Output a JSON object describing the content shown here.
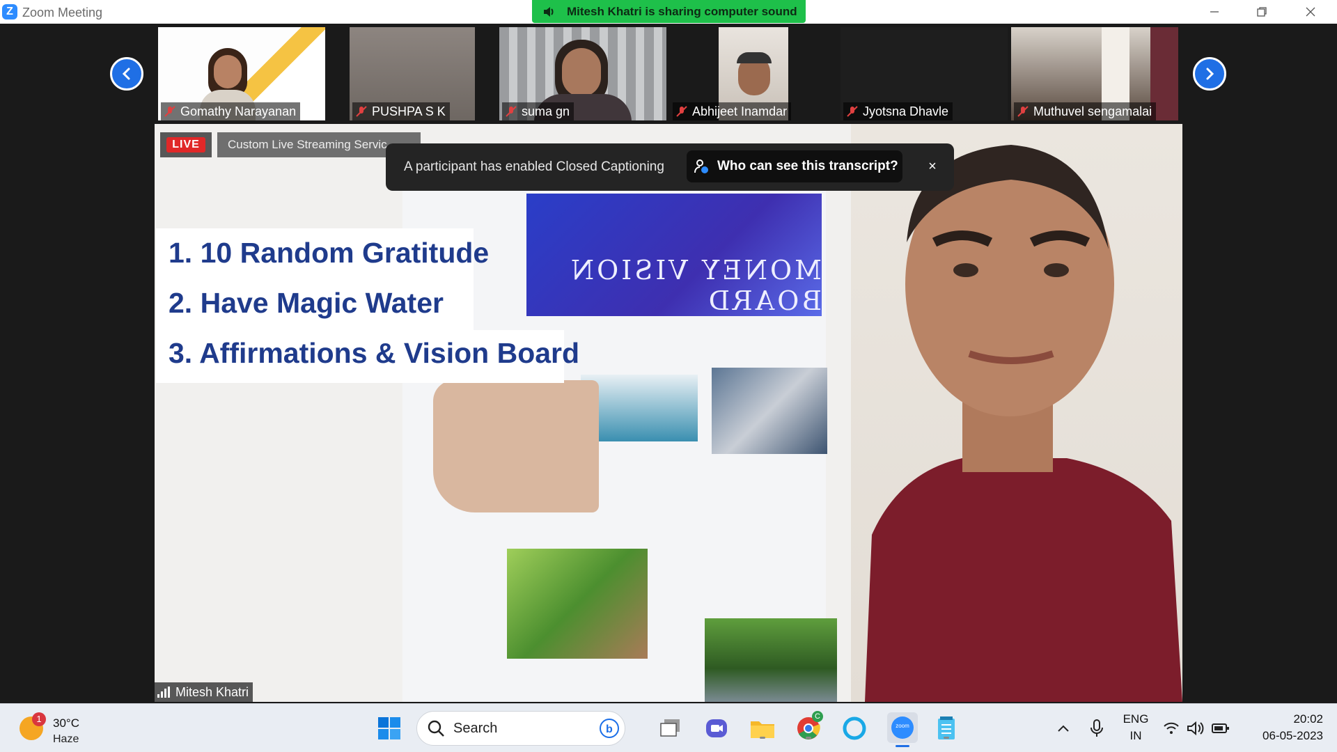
{
  "window": {
    "title": "Zoom Meeting",
    "sharing_banner": "Mitesh Khatri is sharing computer sound"
  },
  "participants": [
    {
      "name": "Gomathy Narayanan",
      "muted": true
    },
    {
      "name": "PUSHPA S K",
      "muted": true
    },
    {
      "name": "suma gn",
      "muted": true
    },
    {
      "name": "Abhijeet Inamdar",
      "muted": true
    },
    {
      "name": "Jyotsna Dhavle",
      "muted": true
    },
    {
      "name": "Muthuvel sengamalai",
      "muted": true
    }
  ],
  "stage": {
    "live_label": "LIVE",
    "stream_label": "Custom Live Streaming Servic",
    "cc_notice": "A participant has enabled Closed Captioning",
    "cc_link": "Who can see this transcript?",
    "close_symbol": "×",
    "overlay_items": [
      "1. 10 Random Gratitude",
      "2. Have Magic Water",
      "3. Affirmations & Vision Board"
    ],
    "poster_title": "MONEY VISION BOARD",
    "speaker_name": "Mitesh Khatri"
  },
  "taskbar": {
    "weather": {
      "temp": "30°C",
      "condition": "Haze",
      "badge": "1"
    },
    "search_label": "Search",
    "language": [
      "ENG",
      "IN"
    ],
    "time": "20:02",
    "date": "06-05-2023",
    "chrome_badge": "C",
    "zoom_icon_label": "zoom"
  },
  "colors": {
    "accent": "#2d8cff",
    "sharing_green": "#1ec04a",
    "live_red": "#e02828",
    "overlay_text": "#1f3b8c"
  }
}
